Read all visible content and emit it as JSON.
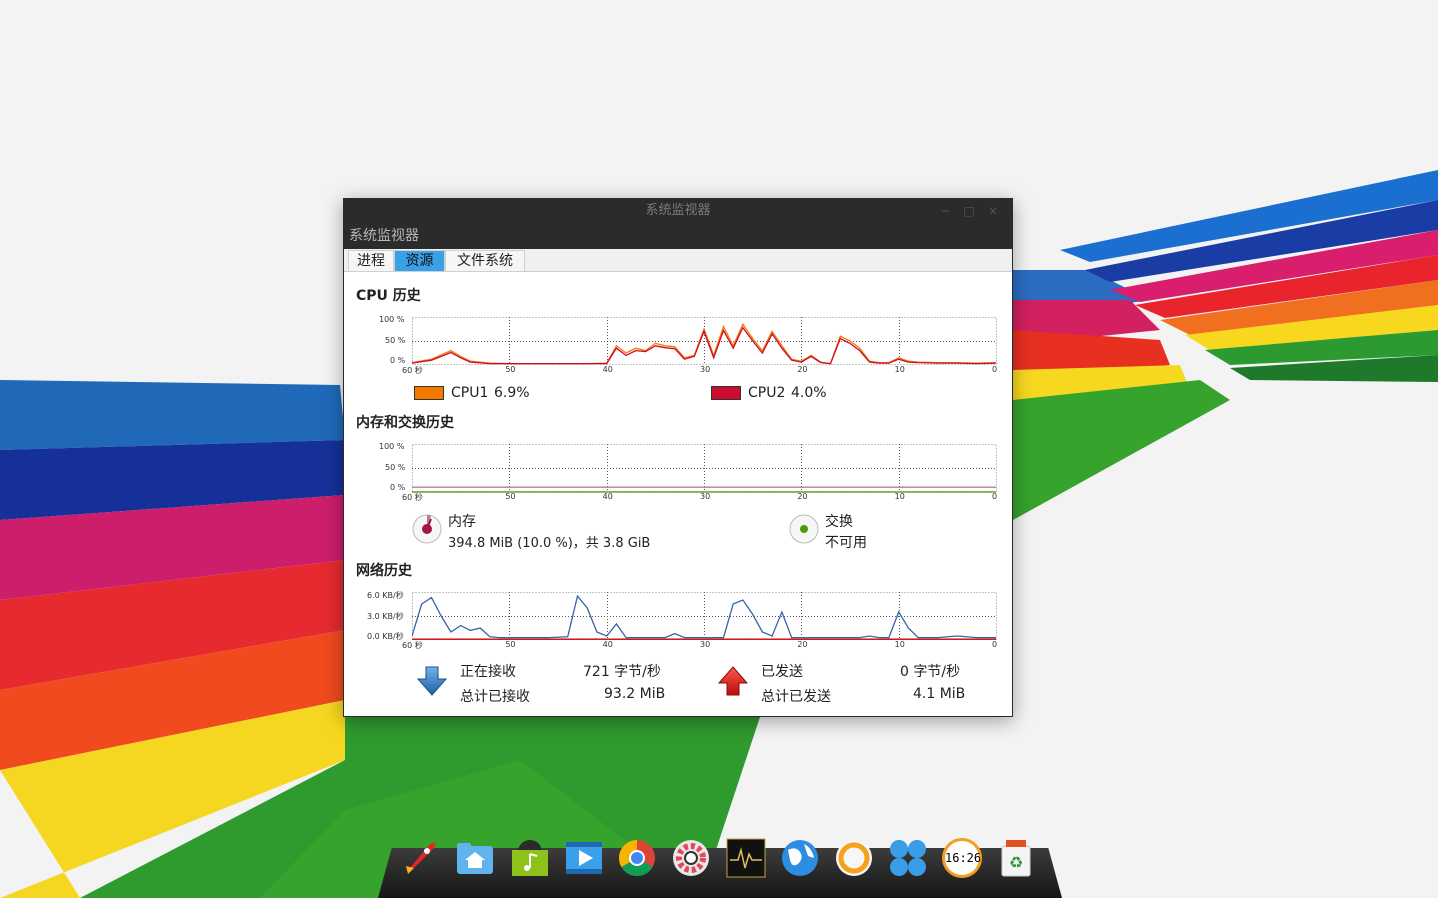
{
  "window": {
    "title": "系统监视器",
    "menu_title": "系统监视器",
    "controls": [
      "−",
      "□",
      "×"
    ]
  },
  "tabs": [
    {
      "label": "进程",
      "active": false
    },
    {
      "label": "资源",
      "active": true
    },
    {
      "label": "文件系统",
      "active": false
    }
  ],
  "cpu": {
    "title": "CPU 历史",
    "y_ticks": [
      "100 %",
      "50 %",
      "0 %"
    ],
    "x_ticks": [
      "60 秒",
      "50",
      "40",
      "30",
      "20",
      "10",
      "0"
    ],
    "legend": [
      {
        "name": "CPU1",
        "value": "6.9%",
        "color": "#f57900"
      },
      {
        "name": "CPU2",
        "value": "4.0%",
        "color": "#cc0c2f"
      }
    ]
  },
  "memory": {
    "title": "内存和交换历史",
    "y_ticks": [
      "100 %",
      "50 %",
      "0 %"
    ],
    "x_ticks": [
      "60 秒",
      "50",
      "40",
      "30",
      "20",
      "10",
      "0"
    ],
    "mem_label": "内存",
    "mem_value": "394.8 MiB (10.0 %)，共 3.8 GiB",
    "swap_label": "交换",
    "swap_value": "不可用"
  },
  "network": {
    "title": "网络历史",
    "y_ticks": [
      "6.0 KB/秒",
      "3.0 KB/秒",
      "0.0 KB/秒"
    ],
    "x_ticks": [
      "60 秒",
      "50",
      "40",
      "30",
      "20",
      "10",
      "0"
    ],
    "recv_label": "正在接收",
    "recv_rate": "721 字节/秒",
    "recv_total_label": "总计已接收",
    "recv_total": "93.2 MiB",
    "sent_label": "已发送",
    "sent_rate": "0 字节/秒",
    "sent_total_label": "总计已发送",
    "sent_total": "4.1 MiB"
  },
  "chart_data": [
    {
      "type": "line",
      "title": "CPU 历史",
      "x": [
        60,
        58,
        56,
        55,
        54,
        52,
        50,
        48,
        46,
        44,
        42,
        40,
        39,
        38,
        37,
        36,
        35,
        34,
        33,
        32,
        31,
        30,
        29,
        28,
        27,
        26,
        25,
        24,
        23,
        22,
        21,
        20,
        19,
        18,
        17,
        16,
        15,
        14,
        13,
        12,
        11,
        10,
        9,
        8,
        6,
        4,
        2,
        0
      ],
      "series": [
        {
          "name": "CPU1",
          "values": [
            5,
            12,
            30,
            18,
            8,
            4,
            3,
            3,
            3,
            3,
            3,
            4,
            40,
            25,
            35,
            30,
            45,
            40,
            38,
            15,
            20,
            75,
            20,
            80,
            40,
            85,
            55,
            30,
            70,
            40,
            12,
            8,
            20,
            6,
            3,
            60,
            50,
            35,
            8,
            5,
            5,
            15,
            8,
            6,
            5,
            5,
            4,
            5
          ]
        },
        {
          "name": "CPU2",
          "values": [
            4,
            10,
            26,
            15,
            6,
            3,
            3,
            3,
            3,
            3,
            3,
            3,
            35,
            20,
            30,
            28,
            40,
            36,
            34,
            12,
            18,
            70,
            15,
            72,
            35,
            78,
            50,
            25,
            65,
            35,
            10,
            6,
            18,
            5,
            3,
            55,
            45,
            30,
            6,
            4,
            4,
            12,
            6,
            5,
            4,
            4,
            3,
            4
          ]
        }
      ],
      "ylim": [
        0,
        100
      ],
      "grid": true
    },
    {
      "type": "line",
      "title": "内存和交换历史",
      "x": [
        60,
        0
      ],
      "series": [
        {
          "name": "内存",
          "values": [
            10,
            10
          ]
        },
        {
          "name": "交换",
          "values": [
            0,
            0
          ]
        }
      ],
      "ylim": [
        0,
        100
      ],
      "grid": true
    },
    {
      "type": "line",
      "title": "网络历史",
      "x": [
        60,
        59,
        58,
        57,
        56,
        55,
        54,
        53,
        52,
        51,
        50,
        48,
        46,
        44,
        43,
        42,
        41,
        40,
        39,
        38,
        36,
        34,
        33,
        32,
        30,
        28,
        27,
        26,
        25,
        24,
        23,
        22,
        21,
        20,
        18,
        16,
        14,
        13,
        12,
        11,
        10,
        9,
        8,
        6,
        4,
        2,
        0
      ],
      "series": [
        {
          "name": "接收",
          "values": [
            0.5,
            4.5,
            5.3,
            3.0,
            1.0,
            1.8,
            1.2,
            1.5,
            0.4,
            0.3,
            0.3,
            0.3,
            0.3,
            0.4,
            5.5,
            4.0,
            1.0,
            0.5,
            2.0,
            0.3,
            0.3,
            0.3,
            0.8,
            0.3,
            0.3,
            0.3,
            4.5,
            5.0,
            3.2,
            1.0,
            0.5,
            3.5,
            0.3,
            0.3,
            0.3,
            0.3,
            0.3,
            0.5,
            0.3,
            0.3,
            3.5,
            1.5,
            0.3,
            0.3,
            0.5,
            0.3,
            0.3
          ]
        },
        {
          "name": "发送",
          "values": [
            0.1,
            0.1,
            0.1,
            0.1,
            0.1,
            0.1,
            0.1,
            0.1,
            0.1,
            0.1,
            0.1,
            0.1,
            0.1,
            0.1,
            0.1,
            0.1,
            0.1,
            0.1,
            0.1,
            0.1,
            0.1,
            0.1,
            0.1,
            0.1,
            0.1,
            0.1,
            0.1,
            0.1,
            0.1,
            0.1,
            0.1,
            0.1,
            0.1,
            0.1,
            0.1,
            0.1,
            0.1,
            0.1,
            0.1,
            0.1,
            0.1,
            0.1,
            0.1,
            0.1,
            0.1,
            0.1,
            0.1
          ]
        }
      ],
      "ylim": [
        0,
        6
      ],
      "grid": true
    }
  ],
  "dock": {
    "items": [
      {
        "name": "launcher",
        "icon": "rocket-icon"
      },
      {
        "name": "files",
        "icon": "home-folder-icon"
      },
      {
        "name": "music",
        "icon": "music-note-icon"
      },
      {
        "name": "video",
        "icon": "video-play-icon"
      },
      {
        "name": "chrome",
        "icon": "chrome-icon"
      },
      {
        "name": "settings",
        "icon": "gear-icon"
      },
      {
        "name": "system-monitor",
        "icon": "monitor-pulse-icon"
      },
      {
        "name": "network",
        "icon": "globe-icon"
      },
      {
        "name": "browser",
        "icon": "orange-circle-icon"
      },
      {
        "name": "app-center",
        "icon": "app-grid-icon"
      },
      {
        "name": "clock",
        "icon": "clock-icon"
      },
      {
        "name": "trash",
        "icon": "trash-icon"
      }
    ],
    "clock_text": "16:26"
  }
}
